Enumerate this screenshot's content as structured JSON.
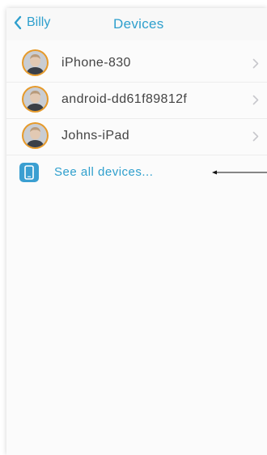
{
  "nav": {
    "back_label": "Billy",
    "title": "Devices"
  },
  "devices": [
    {
      "name": "iPhone-830"
    },
    {
      "name": "android-dd61f89812f"
    },
    {
      "name": "Johns-iPad"
    }
  ],
  "see_all": {
    "label": "See all devices..."
  },
  "colors": {
    "accent": "#2e9fcd",
    "avatar_ring": "#e69a2b",
    "device_icon_bg": "#3b9fd1"
  },
  "icons": {
    "back": "chevron-left-icon",
    "row_disclosure": "chevron-right-icon",
    "device": "tablet-icon",
    "annotation": "arrow-left-icon"
  }
}
